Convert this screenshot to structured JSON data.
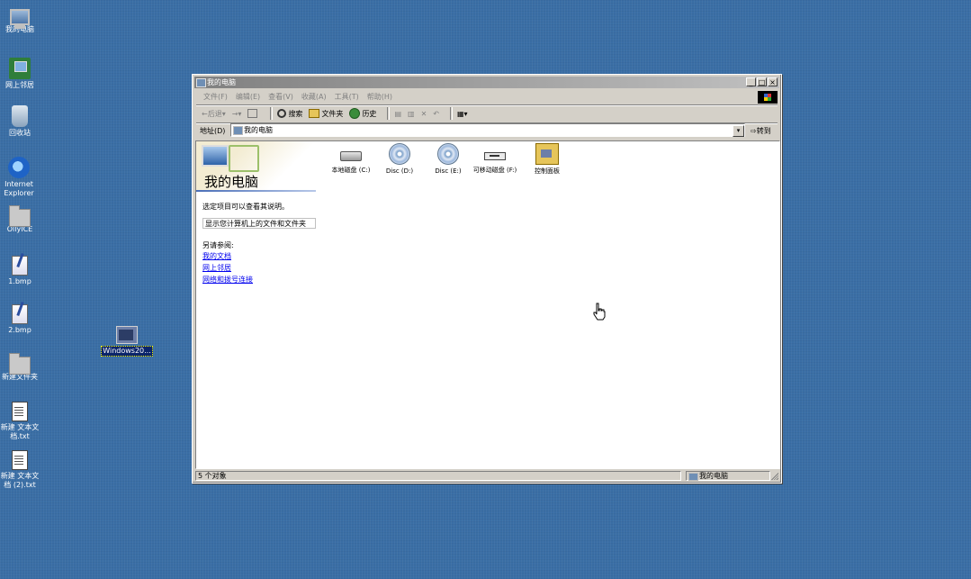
{
  "desktop": {
    "icons": [
      {
        "label": "我的电脑",
        "icon": "monitor-icon"
      },
      {
        "label": "网上邻居",
        "icon": "network-icon"
      },
      {
        "label": "回收站",
        "icon": "recycle-bin-icon"
      },
      {
        "label": "Internet Explorer",
        "icon": "internet-explorer-icon"
      },
      {
        "label": "OllyICE",
        "icon": "folder-icon"
      },
      {
        "label": "1.bmp",
        "icon": "paint-icon"
      },
      {
        "label": "2.bmp",
        "icon": "paint-icon"
      },
      {
        "label": "新建文件夹",
        "icon": "folder-icon"
      },
      {
        "label": "新建 文本文档.txt",
        "icon": "text-document-icon"
      },
      {
        "label": "新建 文本文档 (2).txt",
        "icon": "text-document-icon"
      },
      {
        "label": "Windows20...",
        "icon": "window-icon"
      }
    ]
  },
  "window": {
    "title": "我的电脑",
    "menu": [
      "文件(F)",
      "编辑(E)",
      "查看(V)",
      "收藏(A)",
      "工具(T)",
      "帮助(H)"
    ],
    "toolbar": {
      "back": "←后退",
      "search": "搜索",
      "folders": "文件夹",
      "history": "历史"
    },
    "address": {
      "label": "地址(D)",
      "value": "我的电脑",
      "go": "转到"
    },
    "panel": {
      "title": "我的电脑",
      "description": "选定项目可以查看其说明。",
      "show_button": "显示您计算机上的文件和文件夹",
      "see_also": "另请参阅:",
      "links": [
        "我的文档",
        "网上邻居",
        "网络和拨号连接"
      ]
    },
    "items": [
      {
        "label": "本地磁盘 (C:)",
        "icon": "hard-drive-icon"
      },
      {
        "label": "Disc (D:)",
        "icon": "cd-drive-icon"
      },
      {
        "label": "Disc (E:)",
        "icon": "cd-drive-icon"
      },
      {
        "label": "可移动磁盘 (F:)",
        "icon": "removable-drive-icon"
      },
      {
        "label": "控制面板",
        "icon": "control-panel-icon"
      }
    ],
    "status": {
      "count": "5 个对象",
      "location": "我的电脑"
    }
  }
}
